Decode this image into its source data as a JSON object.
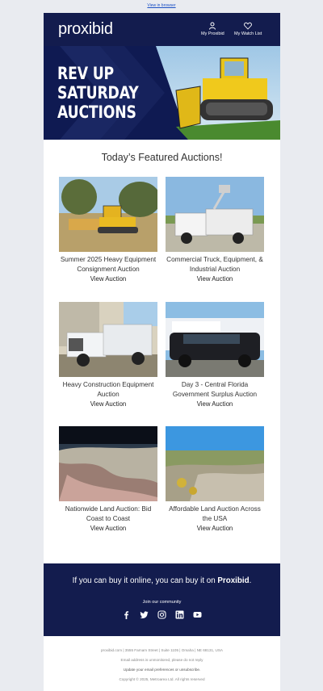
{
  "preheader": {
    "view_in_browser": "View in browser"
  },
  "header": {
    "logo": "proxibid",
    "nav": [
      {
        "label": "My Proxibid",
        "icon": "user-icon"
      },
      {
        "label": "My Watch List",
        "icon": "heart-icon"
      }
    ]
  },
  "hero": {
    "title_lines": [
      "REV UP",
      "SATURDAY",
      "AUCTIONS"
    ]
  },
  "featured": {
    "title": "Today’s Featured Auctions!",
    "cards": [
      {
        "name": "Summer 2025 Heavy Equipment Consignment Auction",
        "link": "View Auction",
        "image": "bulldozer-photo"
      },
      {
        "name": "Commercial Truck, Equipment, & Industrial Auction",
        "link": "View Auction",
        "image": "utility-truck-photo"
      },
      {
        "name": "Heavy Construction Equipment Auction",
        "link": "View Auction",
        "image": "pickup-truck-photo"
      },
      {
        "name": "Day 3 - Central Florida Government Surplus Auction",
        "link": "View Auction",
        "image": "suv-photo"
      },
      {
        "name": "Nationwide Land Auction: Bid Coast to Coast",
        "link": "View Auction",
        "image": "aerial-land-photo"
      },
      {
        "name": "Affordable Land Auction Across the USA",
        "link": "View Auction",
        "image": "desert-land-photo"
      }
    ]
  },
  "footer": {
    "tagline_prefix": "If you can buy it online, you can buy it on ",
    "tagline_brand": "Proxibid",
    "tagline_suffix": ".",
    "join": "Join our community",
    "socials": [
      "facebook-icon",
      "twitter-icon",
      "instagram-icon",
      "linkedin-icon",
      "youtube-icon"
    ],
    "address": "proxibid.com | 3555 Farnam Street | Suite 1105 | Omaha | NE 68131, USA",
    "unmonitored": "Email address is unmonitored, please do not reply",
    "preferences": "Update your email preferences or unsubscribe.",
    "copyright": "Copyright © 2025, Metroarea Ltd. All rights reserved"
  }
}
